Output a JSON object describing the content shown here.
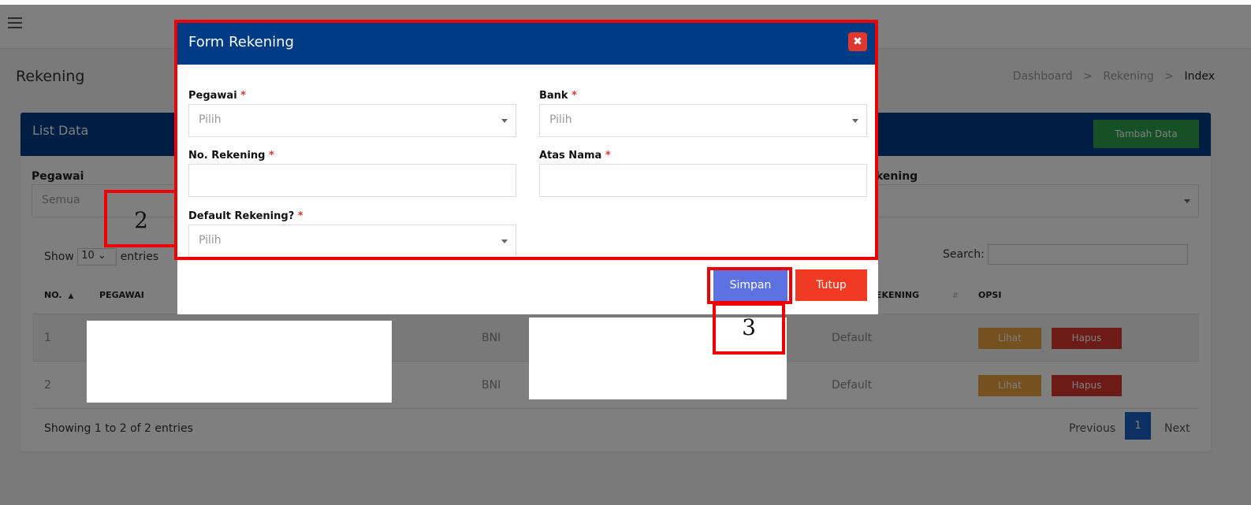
{
  "app": {
    "page_title": "Rekening",
    "breadcrumb": [
      "Dashboard",
      "Rekening",
      "Index"
    ],
    "breadcrumb_sep": ">"
  },
  "card": {
    "title": "List Data",
    "add_button": "Tambah Data",
    "filters": {
      "pegawai_label": "Pegawai",
      "pegawai_value": "Semua",
      "rekening_label": "kening"
    },
    "show_label_pre": "Show",
    "show_value": "10",
    "show_label_post": "entries",
    "search_label": "Search:",
    "columns": [
      "NO.",
      "PEGAWAI",
      "EKENING",
      "OPSI"
    ],
    "rows": [
      {
        "no": "1",
        "bank": "BNI",
        "status": "Default",
        "lihat": "Lihat",
        "hapus": "Hapus"
      },
      {
        "no": "2",
        "bank": "BNI",
        "status": "Default",
        "lihat": "Lihat",
        "hapus": "Hapus"
      }
    ],
    "info": "Showing 1 to 2 of 2 entries",
    "pager": {
      "previous": "Previous",
      "current": "1",
      "next": "Next"
    }
  },
  "modal": {
    "title": "Form Rekening",
    "close_icon": "close-icon",
    "fields": {
      "pegawai": {
        "label": "Pegawai",
        "required": "*",
        "value": "Pilih"
      },
      "bank": {
        "label": "Bank",
        "required": "*",
        "value": "Pilih"
      },
      "no_rekening": {
        "label": "No. Rekening",
        "required": "*",
        "value": ""
      },
      "atas_nama": {
        "label": "Atas Nama",
        "required": "*",
        "value": ""
      },
      "default": {
        "label": "Default Rekening?",
        "required": "*",
        "value": "Pilih"
      }
    },
    "save_button": "Simpan",
    "close_button": "Tutup"
  },
  "annotations": {
    "label_2": "2",
    "label_3": "3"
  },
  "colors": {
    "header_blue": "#003b86",
    "add_green": "#2aa34a",
    "lihat_orange": "#e8a23c",
    "hapus_red": "#d9362e",
    "simpan_blue": "#5b72e0",
    "tutup_red": "#f13a24",
    "annotation_red": "#ee0000"
  }
}
